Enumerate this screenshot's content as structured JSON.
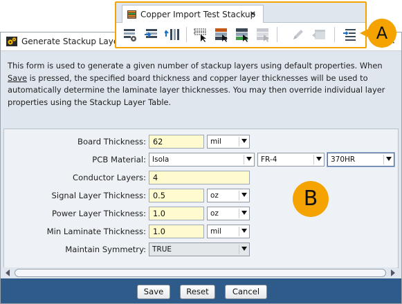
{
  "toolbar": {
    "tab_label": "Copper Import Test Stackup",
    "tab_close": "×",
    "tools": [
      {
        "icon": "stackup-settings-icon",
        "enabled": true
      },
      {
        "icon": "import-layers-icon",
        "enabled": true
      },
      {
        "icon": "export-layers-icon",
        "enabled": true
      },
      {
        "icon": "select-layers-icon",
        "enabled": true
      },
      {
        "icon": "insert-layer-above-icon",
        "enabled": true
      },
      {
        "icon": "insert-layer-below-icon",
        "enabled": true
      },
      {
        "icon": "delete-layer-icon",
        "enabled": false
      },
      {
        "icon": "edit-pencil-icon",
        "enabled": false
      },
      {
        "icon": "layer-properties-icon",
        "enabled": false
      },
      {
        "icon": "generate-stackup-icon",
        "enabled": true
      }
    ]
  },
  "callouts": {
    "a": "A",
    "b": "B"
  },
  "dialog": {
    "title": "Generate Stackup Layers",
    "close": "✕",
    "description_pre": "This form is used to generate a given number of stackup layers using default properties. When ",
    "description_link": "Save",
    "description_post": " is pressed, the specified board thickness and copper layer thicknesses will be used to automatically determine the laminate layer thicknesses. You may then override individual layer properties using the Stackup Layer Table."
  },
  "form": {
    "board_thickness": {
      "label": "Board Thickness:",
      "value": "62",
      "unit": "mil"
    },
    "pcb_material": {
      "label": "PCB Material:",
      "manufacturer": "Isola",
      "type": "FR-4",
      "grade": "370HR"
    },
    "conductor_layers": {
      "label": "Conductor Layers:",
      "value": "4"
    },
    "signal_layer_thickness": {
      "label": "Signal Layer Thickness:",
      "value": "0.5",
      "unit": "oz"
    },
    "power_layer_thickness": {
      "label": "Power Layer Thickness:",
      "value": "1.0",
      "unit": "oz"
    },
    "min_laminate_thickness": {
      "label": "Min Laminate Thickness:",
      "value": "1.0",
      "unit": "mil"
    },
    "maintain_symmetry": {
      "label": "Maintain Symmetry:",
      "value": "TRUE"
    }
  },
  "buttons": {
    "save": "Save",
    "reset": "Reset",
    "cancel": "Cancel"
  },
  "colors": {
    "accent": "#f4a300",
    "button_bar": "#2e5b8a",
    "input_bg": "#fffbcf"
  }
}
